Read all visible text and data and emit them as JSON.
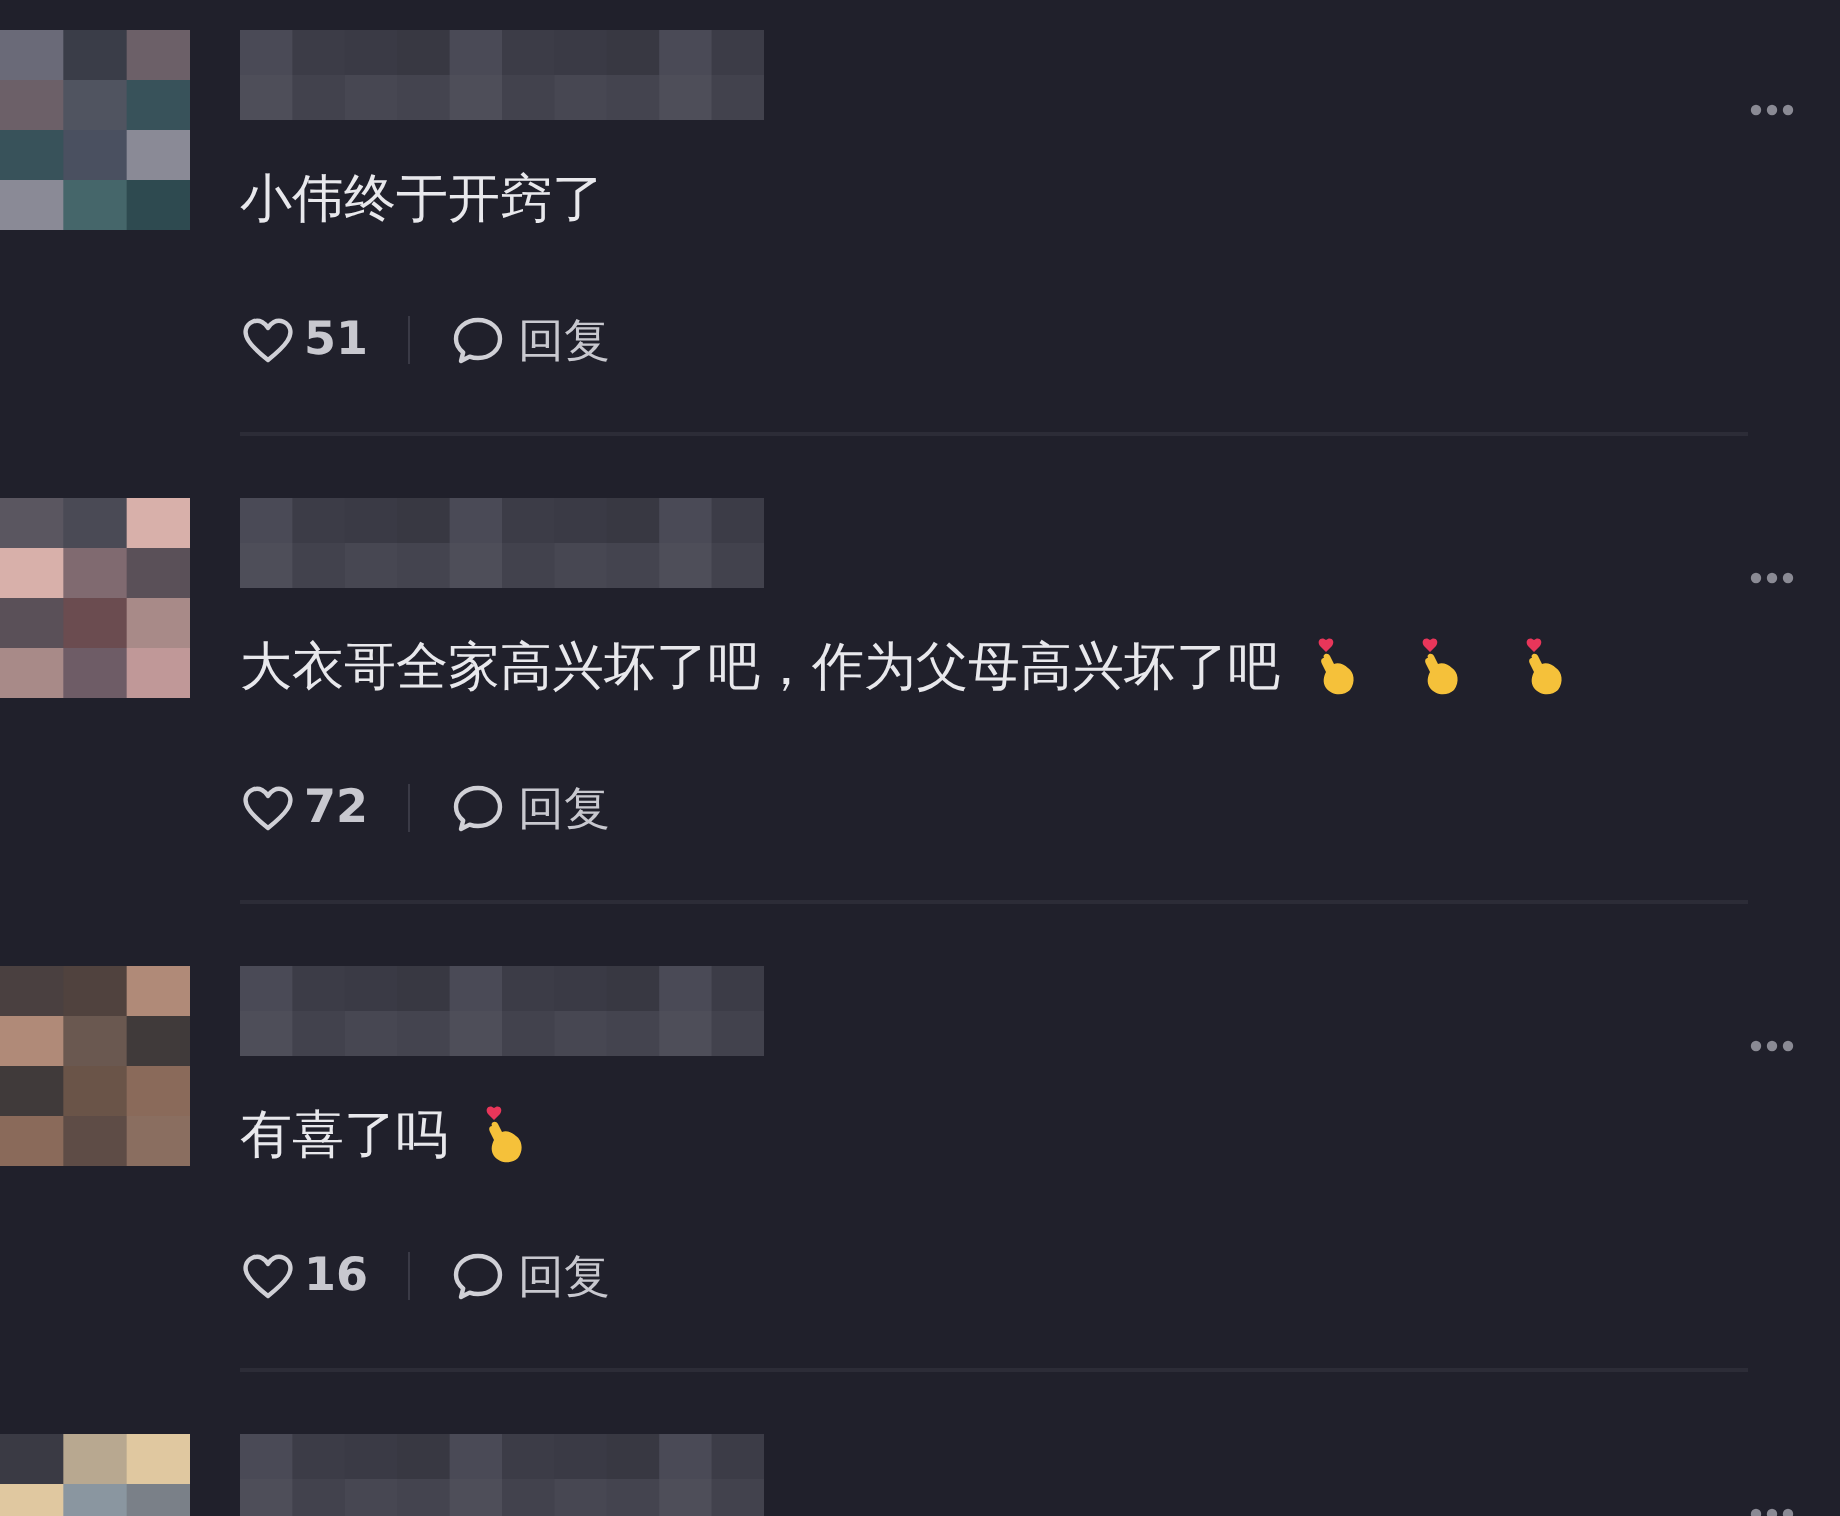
{
  "comments": [
    {
      "kind": "full",
      "text": "小伟终于开窍了",
      "likes": "51",
      "reply": "回复"
    },
    {
      "kind": "full",
      "text": "大衣哥全家高兴坏了吧，作为父母高兴坏了吧",
      "emojis": [
        {
          "kind": "finger-heart"
        },
        {
          "kind": "finger-heart"
        },
        {
          "kind": "finger-heart"
        }
      ],
      "likes": "72",
      "reply": "回复"
    },
    {
      "kind": "full",
      "text": "有喜了吗",
      "emojis": [
        {
          "kind": "finger-heart"
        }
      ],
      "likes": "16",
      "reply": "回复"
    },
    {
      "kind": "partial"
    }
  ]
}
